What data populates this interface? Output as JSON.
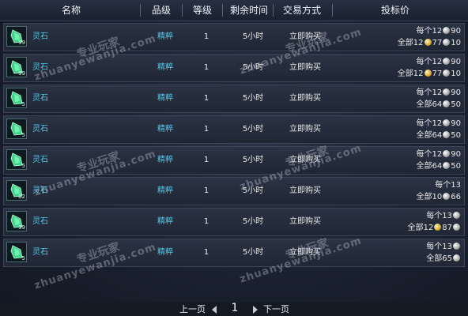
{
  "header": {
    "name": "名称",
    "grade": "品级",
    "level": "等级",
    "time_left": "剩余时间",
    "trade_mode": "交易方式",
    "bid_price": "投标价"
  },
  "rows": [
    {
      "icon": "spirit-stone-icon",
      "stack": "99",
      "name": "灵石",
      "grade": "精粹",
      "level": "1",
      "time": "5小时",
      "trade": "立即购买",
      "line1": {
        "label": "每个12",
        "coins": [
          {
            "type": "silver",
            "value": "90"
          }
        ]
      },
      "line2": {
        "label": "全部12",
        "coins": [
          {
            "type": "gold",
            "value": "77"
          },
          {
            "type": "silver",
            "value": "10"
          }
        ]
      }
    },
    {
      "icon": "spirit-stone-icon",
      "stack": "99",
      "name": "灵石",
      "grade": "精粹",
      "level": "1",
      "time": "5小时",
      "trade": "立即购买",
      "line1": {
        "label": "每个12",
        "coins": [
          {
            "type": "silver",
            "value": "90"
          }
        ]
      },
      "line2": {
        "label": "全部12",
        "coins": [
          {
            "type": "gold",
            "value": "77"
          },
          {
            "type": "silver",
            "value": "10"
          }
        ]
      }
    },
    {
      "icon": "spirit-stone-icon",
      "stack": "5",
      "name": "灵石",
      "grade": "精粹",
      "level": "1",
      "time": "5小时",
      "trade": "立即购买",
      "line1": {
        "label": "每个12",
        "coins": [
          {
            "type": "silver",
            "value": "90"
          }
        ]
      },
      "line2": {
        "label": "全部64",
        "coins": [
          {
            "type": "silver",
            "value": "50"
          }
        ]
      }
    },
    {
      "icon": "spirit-stone-icon",
      "stack": "5",
      "name": "灵石",
      "grade": "精粹",
      "level": "1",
      "time": "5小时",
      "trade": "立即购买",
      "line1": {
        "label": "每个12",
        "coins": [
          {
            "type": "silver",
            "value": "90"
          }
        ]
      },
      "line2": {
        "label": "全部64",
        "coins": [
          {
            "type": "silver",
            "value": "50"
          }
        ]
      }
    },
    {
      "icon": "spirit-stone-icon",
      "stack": "5",
      "name": "灵石",
      "grade": "精粹",
      "level": "1",
      "time": "5小时",
      "trade": "立即购买",
      "line1": {
        "label": "每个12",
        "coins": [
          {
            "type": "silver",
            "value": "90"
          }
        ]
      },
      "line2": {
        "label": "全部64",
        "coins": [
          {
            "type": "silver",
            "value": "50"
          }
        ]
      }
    },
    {
      "icon": "spirit-stone-icon",
      "stack": "82",
      "name": "灵石",
      "grade": "精粹",
      "level": "1",
      "time": "5小时",
      "trade": "立即购买",
      "line1": {
        "label": "每个13",
        "coins": []
      },
      "line2": {
        "label": "全部10",
        "coins": [
          {
            "type": "silver",
            "value": "66"
          }
        ]
      }
    },
    {
      "icon": "spirit-stone-icon",
      "stack": "99",
      "name": "灵石",
      "grade": "精粹",
      "level": "1",
      "time": "5小时",
      "trade": "立即购买",
      "line1": {
        "label": "每个13",
        "coins": [
          {
            "type": "silver",
            "value": ""
          }
        ]
      },
      "line2": {
        "label": "全部12",
        "coins": [
          {
            "type": "gold",
            "value": "87"
          },
          {
            "type": "silver",
            "value": ""
          }
        ]
      }
    },
    {
      "icon": "spirit-stone-icon",
      "stack": "5",
      "name": "灵石",
      "grade": "精粹",
      "level": "1",
      "time": "5小时",
      "trade": "立即购买",
      "line1": {
        "label": "每个13",
        "coins": [
          {
            "type": "silver",
            "value": ""
          }
        ]
      },
      "line2": {
        "label": "全部65",
        "coins": [
          {
            "type": "silver",
            "value": ""
          }
        ]
      }
    }
  ],
  "pagination": {
    "prev": "上一页",
    "page": "1",
    "next": "下一页"
  },
  "watermark": {
    "cn": "专业玩家",
    "pinyin": "zhuanyewanjia.com"
  }
}
